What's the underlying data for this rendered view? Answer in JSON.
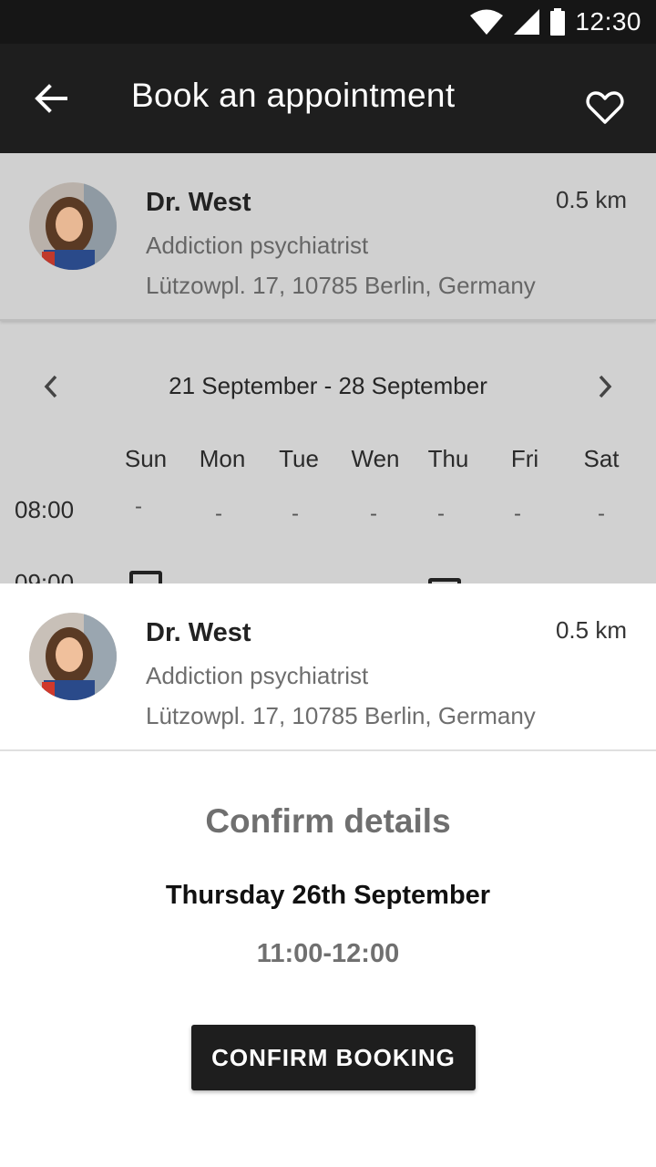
{
  "status_bar": {
    "time": "12:30",
    "icons": [
      "wifi-icon",
      "signal-icon",
      "battery-icon"
    ]
  },
  "app_bar": {
    "title": "Book an appointment",
    "back_icon": "arrow-left-icon",
    "favorite_icon": "heart-outline-icon"
  },
  "doctor": {
    "name": "Dr. West",
    "distance": "0.5 km",
    "specialty": "Addiction psychiatrist",
    "address": "Lützowpl. 17, 10785 Berlin, Germany"
  },
  "calendar": {
    "range": "21 September - 28 September",
    "days": [
      "Sun",
      "Mon",
      "Tue",
      "Wen",
      "Thu",
      "Fri",
      "Sat"
    ],
    "times": [
      "08:00",
      "09:00"
    ],
    "row_0800": [
      "-",
      "-",
      "-",
      "-",
      "-",
      "-",
      "-"
    ]
  },
  "confirm": {
    "title": "Confirm details",
    "date": "Thursday 26th September",
    "time": "11:00-12:00",
    "button_label": "CONFIRM BOOKING"
  },
  "colors": {
    "app_bar": "#1e1e1e",
    "overlay": "#d1d1d1",
    "button": "#1e1e1e"
  }
}
